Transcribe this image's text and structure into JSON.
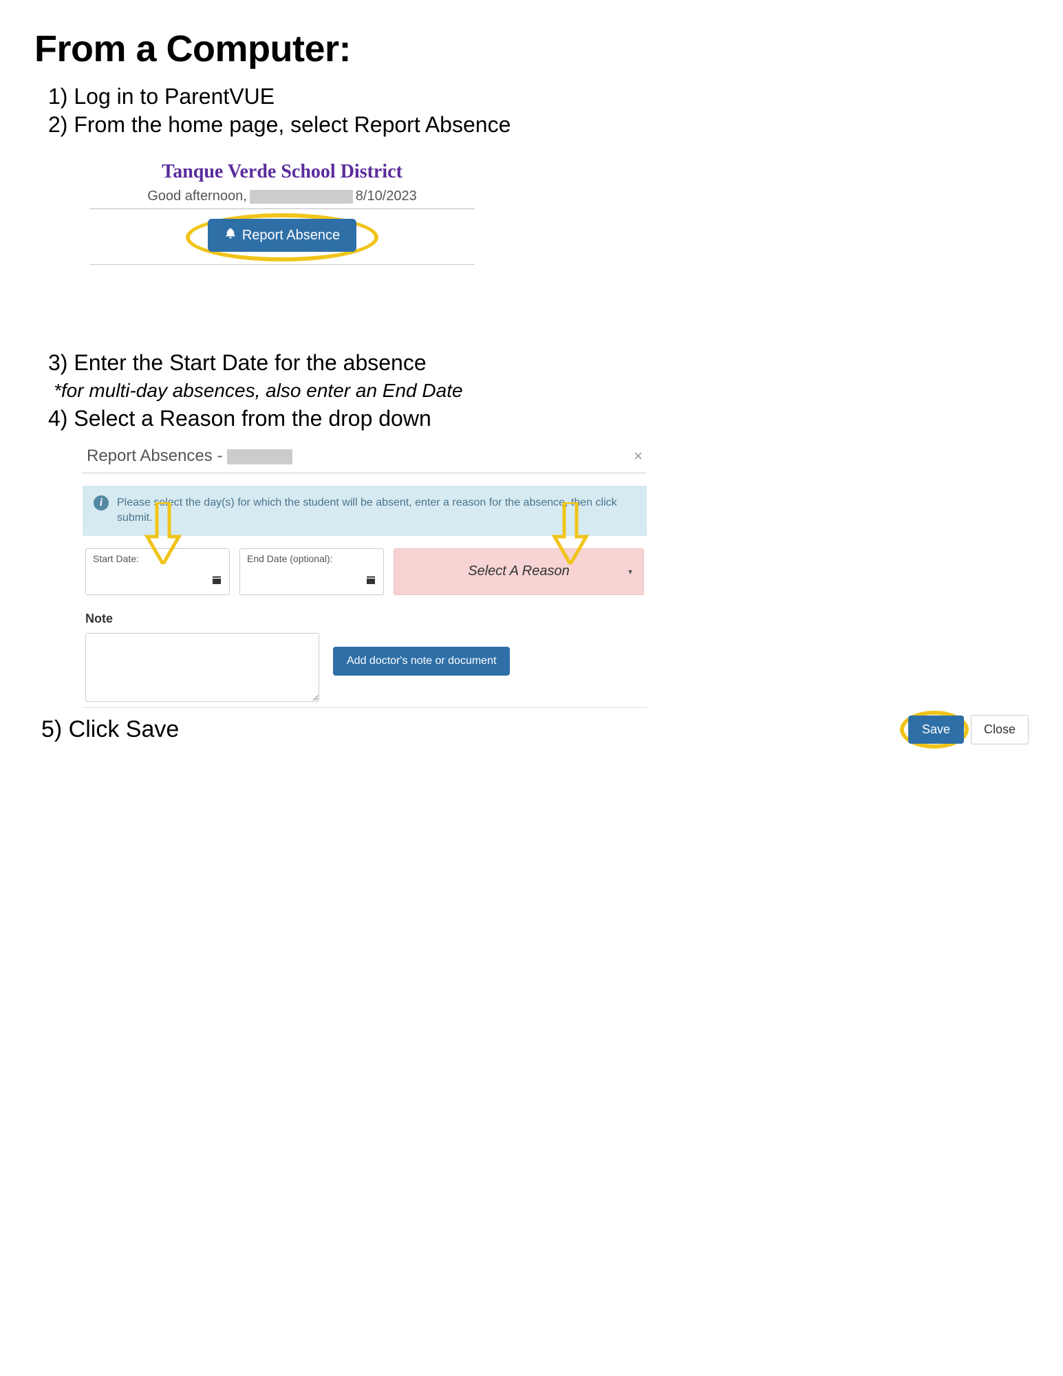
{
  "heading": "From a Computer:",
  "steps": {
    "s1": "1) Log in to ParentVUE",
    "s2": "2) From the home page, select Report Absence",
    "s3": "3) Enter the Start Date for the absence",
    "s3_note": "*for multi-day absences, also enter an End Date",
    "s4": "4) Select a Reason from the drop down",
    "s5": "5) Click Save"
  },
  "screenshot1": {
    "district": "Tanque Verde School District",
    "greeting": "Good afternoon,",
    "date": "8/10/2023",
    "report_absence": "Report Absence"
  },
  "modal": {
    "title_prefix": "Report Absences - ",
    "info_text": "Please select the day(s) for which the student will be absent, enter a reason for the absence, then click submit.",
    "start_date_label": "Start Date:",
    "end_date_label": "End Date (optional):",
    "reason_placeholder": "Select A Reason",
    "note_label": "Note",
    "add_doc": "Add doctor's note or document",
    "save": "Save",
    "close": "Close"
  }
}
